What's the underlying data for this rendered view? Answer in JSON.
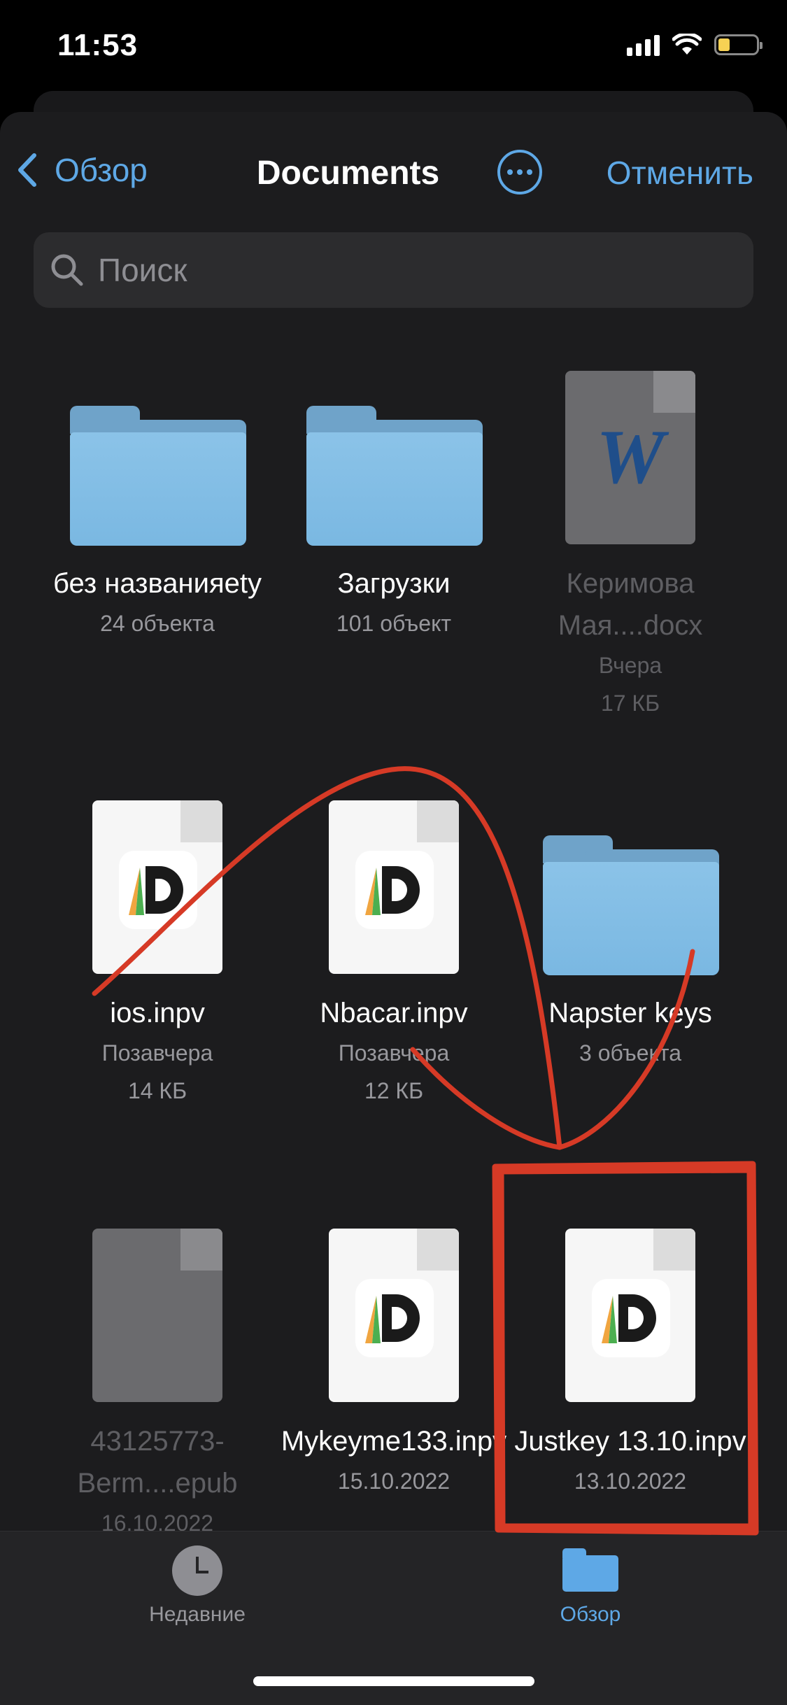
{
  "status_bar": {
    "time": "11:53"
  },
  "navbar": {
    "back_label": "Обзор",
    "title": "Documents",
    "cancel_label": "Отменить"
  },
  "search": {
    "placeholder": "Поиск"
  },
  "items": [
    {
      "name": "без названияety",
      "meta1": "24 объекта",
      "meta2": "",
      "kind": "folder"
    },
    {
      "name": "Загрузки",
      "meta1": "101 объект",
      "meta2": "",
      "kind": "folder"
    },
    {
      "name": "Керимова Мая....docx",
      "meta1": "Вчера",
      "meta2": "17 КБ",
      "kind": "word-doc"
    },
    {
      "name": "ios.inpv",
      "meta1": "Позавчера",
      "meta2": "14 КБ",
      "kind": "inpv"
    },
    {
      "name": "Nbacar.inpv",
      "meta1": "Позавчера",
      "meta2": "12 КБ",
      "kind": "inpv"
    },
    {
      "name": "Napster keys",
      "meta1": "3 объекта",
      "meta2": "",
      "kind": "folder"
    },
    {
      "name": "43125773-Berm....epub",
      "meta1": "16.10.2022",
      "meta2": "",
      "kind": "epub"
    },
    {
      "name": "Mykeyme133.inpv",
      "meta1": "15.10.2022",
      "meta2": "",
      "kind": "inpv"
    },
    {
      "name": "Justkey 13.10.inpv",
      "meta1": "13.10.2022",
      "meta2": "",
      "kind": "inpv"
    }
  ],
  "tabbar": {
    "recent_label": "Недавние",
    "browse_label": "Обзор"
  },
  "colors": {
    "accent": "#5ea8e6",
    "annotation": "#d63a26",
    "folder": "#7ab8e2"
  },
  "icons": [
    "back-chevron-icon",
    "more-icon",
    "search-icon",
    "folder-icon",
    "word-doc-icon",
    "inpv-doc-icon",
    "epub-doc-icon",
    "clock-icon",
    "browse-folder-icon"
  ]
}
